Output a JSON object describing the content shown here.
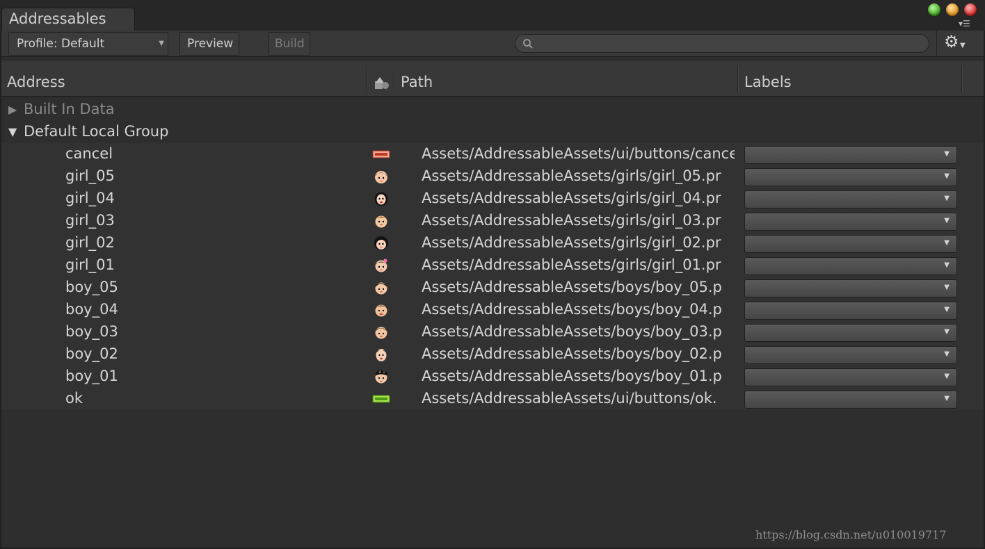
{
  "window": {
    "tab_title": "Addressables"
  },
  "toolbar": {
    "profile_label": "Profile: Default",
    "preview_label": "Preview",
    "build_label": "Build",
    "search_placeholder": ""
  },
  "columns": {
    "address": "Address",
    "path": "Path",
    "labels": "Labels"
  },
  "groups": [
    {
      "name": "Built In Data",
      "expanded": false
    },
    {
      "name": "Default Local Group",
      "expanded": true
    }
  ],
  "entries": [
    {
      "address": "cancel",
      "icon": "button-thumbnail-icon",
      "path": "Assets/AddressableAssets/ui/buttons/cancel"
    },
    {
      "address": "girl_05",
      "icon": "girl-face-icon",
      "path": "Assets/AddressableAssets/girls/girl_05.pr"
    },
    {
      "address": "girl_04",
      "icon": "girl-face-icon",
      "path": "Assets/AddressableAssets/girls/girl_04.pr"
    },
    {
      "address": "girl_03",
      "icon": "girl-face-icon",
      "path": "Assets/AddressableAssets/girls/girl_03.pr"
    },
    {
      "address": "girl_02",
      "icon": "girl-face-icon",
      "path": "Assets/AddressableAssets/girls/girl_02.pr"
    },
    {
      "address": "girl_01",
      "icon": "girl-face-icon",
      "path": "Assets/AddressableAssets/girls/girl_01.pr"
    },
    {
      "address": "boy_05",
      "icon": "boy-face-icon",
      "path": "Assets/AddressableAssets/boys/boy_05.p"
    },
    {
      "address": "boy_04",
      "icon": "boy-face-icon",
      "path": "Assets/AddressableAssets/boys/boy_04.p"
    },
    {
      "address": "boy_03",
      "icon": "boy-face-icon",
      "path": "Assets/AddressableAssets/boys/boy_03.p"
    },
    {
      "address": "boy_02",
      "icon": "boy-face-icon",
      "path": "Assets/AddressableAssets/boys/boy_02.p"
    },
    {
      "address": "boy_01",
      "icon": "boy-face-icon",
      "path": "Assets/AddressableAssets/boys/boy_01.p"
    },
    {
      "address": "ok",
      "icon": "button-thumbnail-icon",
      "path": "Assets/AddressableAssets/ui/buttons/ok."
    }
  ],
  "watermark": "https://blog.csdn.net/u010019717",
  "colors": {
    "background": "#2e2e2e",
    "header": "#383838",
    "text": "#d6d6d6",
    "muted_text": "#8a8a8a"
  }
}
